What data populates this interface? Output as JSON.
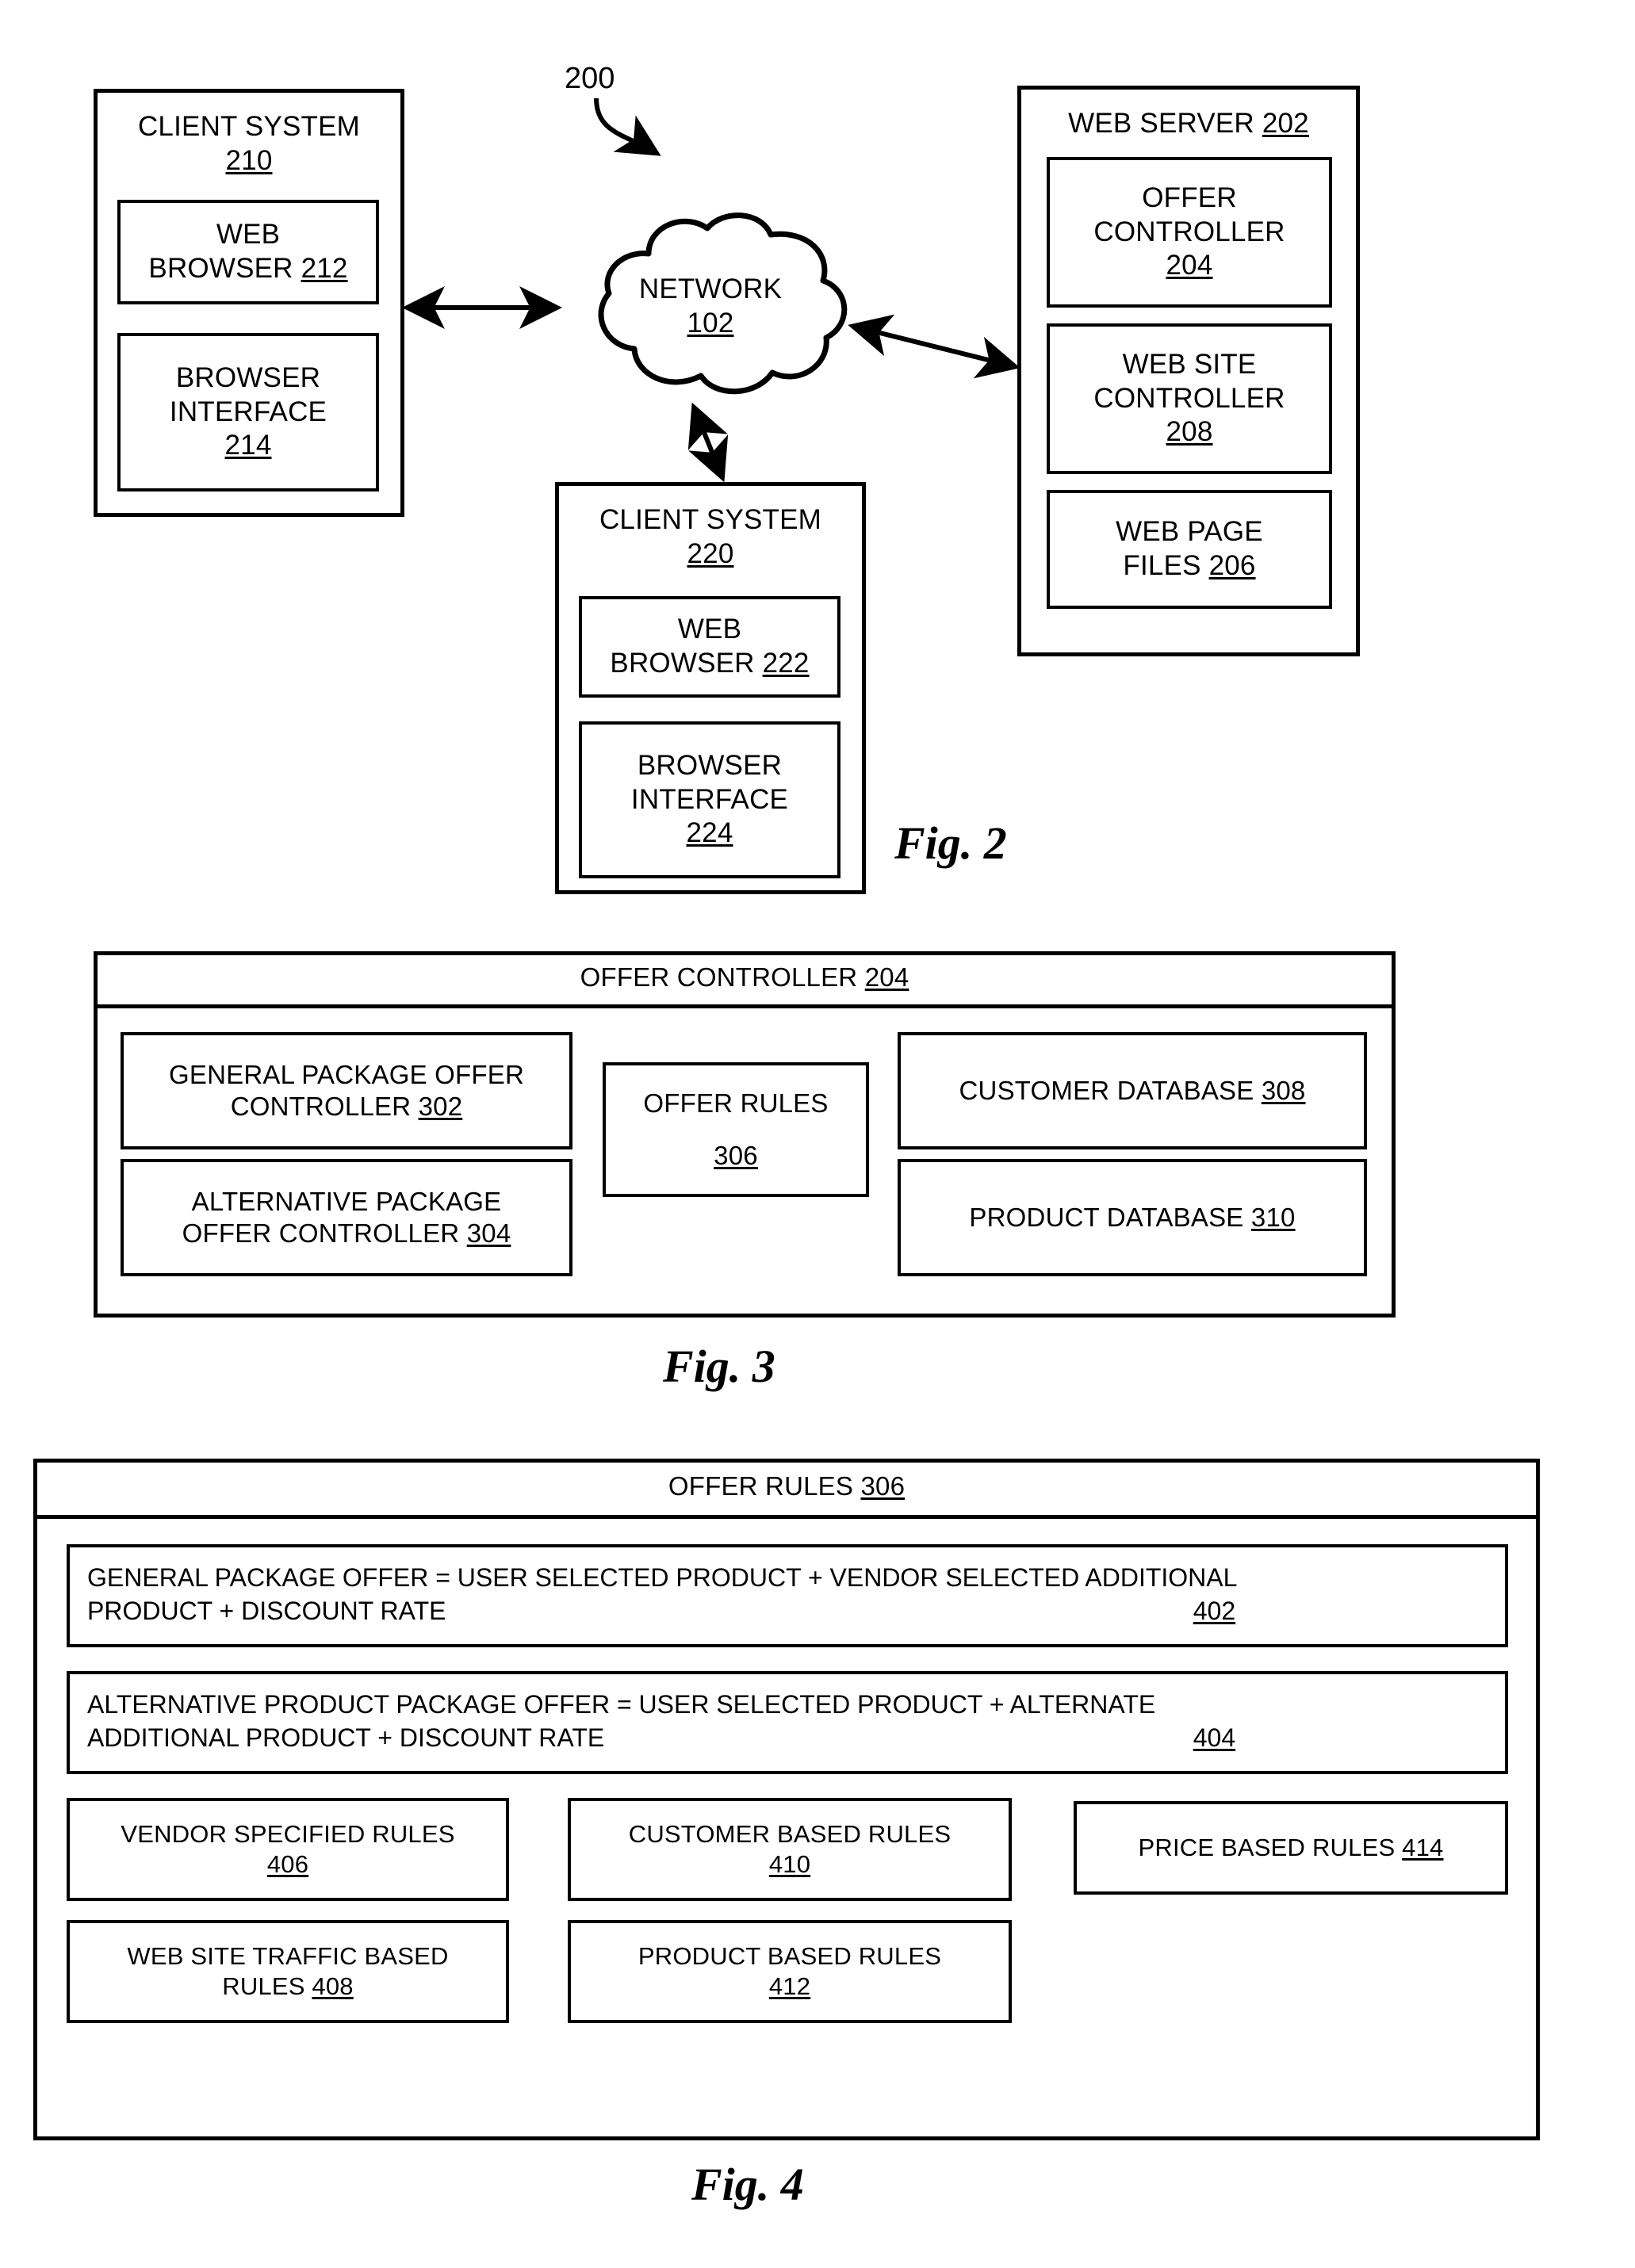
{
  "figures": {
    "fig2": {
      "caption": "Fig. 2",
      "system_ref": "200",
      "network": {
        "name": "NETWORK",
        "ref": "102"
      },
      "client_210": {
        "title": "CLIENT SYSTEM",
        "ref": "210",
        "web_browser": {
          "line1": "WEB",
          "line2": "BROWSER ",
          "ref": "212"
        },
        "browser_interface": {
          "line1": "BROWSER",
          "line2": "INTERFACE",
          "ref": "214"
        }
      },
      "client_220": {
        "title": "CLIENT SYSTEM",
        "ref": "220",
        "web_browser": {
          "line1": "WEB",
          "line2": "BROWSER ",
          "ref": "222"
        },
        "browser_interface": {
          "line1": "BROWSER",
          "line2": "INTERFACE",
          "ref": "224"
        }
      },
      "web_server": {
        "title": "WEB SERVER ",
        "ref": "202",
        "offer_controller": {
          "line1": "OFFER",
          "line2": "CONTROLLER",
          "ref": "204"
        },
        "web_site_controller": {
          "line1": "WEB SITE",
          "line2": "CONTROLLER",
          "ref": "208"
        },
        "web_page_files": {
          "line1": "WEB PAGE",
          "line2": "FILES ",
          "ref": "206"
        }
      }
    },
    "fig3": {
      "caption": "Fig. 3",
      "title": "OFFER CONTROLLER ",
      "title_ref": "204",
      "general_package_offer_controller": {
        "line1": "GENERAL PACKAGE OFFER",
        "line2": "CONTROLLER ",
        "ref": "302"
      },
      "alternative_package_offer_controller": {
        "line1": "ALTERNATIVE PACKAGE",
        "line2": "OFFER CONTROLLER ",
        "ref": "304"
      },
      "offer_rules": {
        "line1": "OFFER RULES",
        "ref": "306"
      },
      "customer_database": {
        "line1": "CUSTOMER DATABASE ",
        "ref": "308"
      },
      "product_database": {
        "line1": "PRODUCT DATABASE ",
        "ref": "310"
      }
    },
    "fig4": {
      "caption": "Fig. 4",
      "title": "OFFER RULES ",
      "title_ref": "306",
      "rule_402": {
        "line1": "GENERAL PACKAGE OFFER  = USER SELECTED PRODUCT + VENDOR SELECTED ADDITIONAL",
        "line2": "PRODUCT + DISCOUNT RATE",
        "ref": "402"
      },
      "rule_404": {
        "line1": "ALTERNATIVE PRODUCT PACKAGE OFFER  = USER SELECTED PRODUCT + ALTERNATE",
        "line2": "ADDITIONAL PRODUCT + DISCOUNT RATE",
        "ref": "404"
      },
      "rule_406": {
        "line1": "VENDOR SPECIFIED RULES",
        "ref": "406"
      },
      "rule_408": {
        "line1": "WEB SITE TRAFFIC BASED",
        "line2": "RULES ",
        "ref": "408"
      },
      "rule_410": {
        "line1": "CUSTOMER BASED RULES",
        "ref": "410"
      },
      "rule_412": {
        "line1": "PRODUCT BASED RULES",
        "ref": "412"
      },
      "rule_414": {
        "line1": "PRICE BASED RULES ",
        "ref": "414"
      }
    }
  }
}
